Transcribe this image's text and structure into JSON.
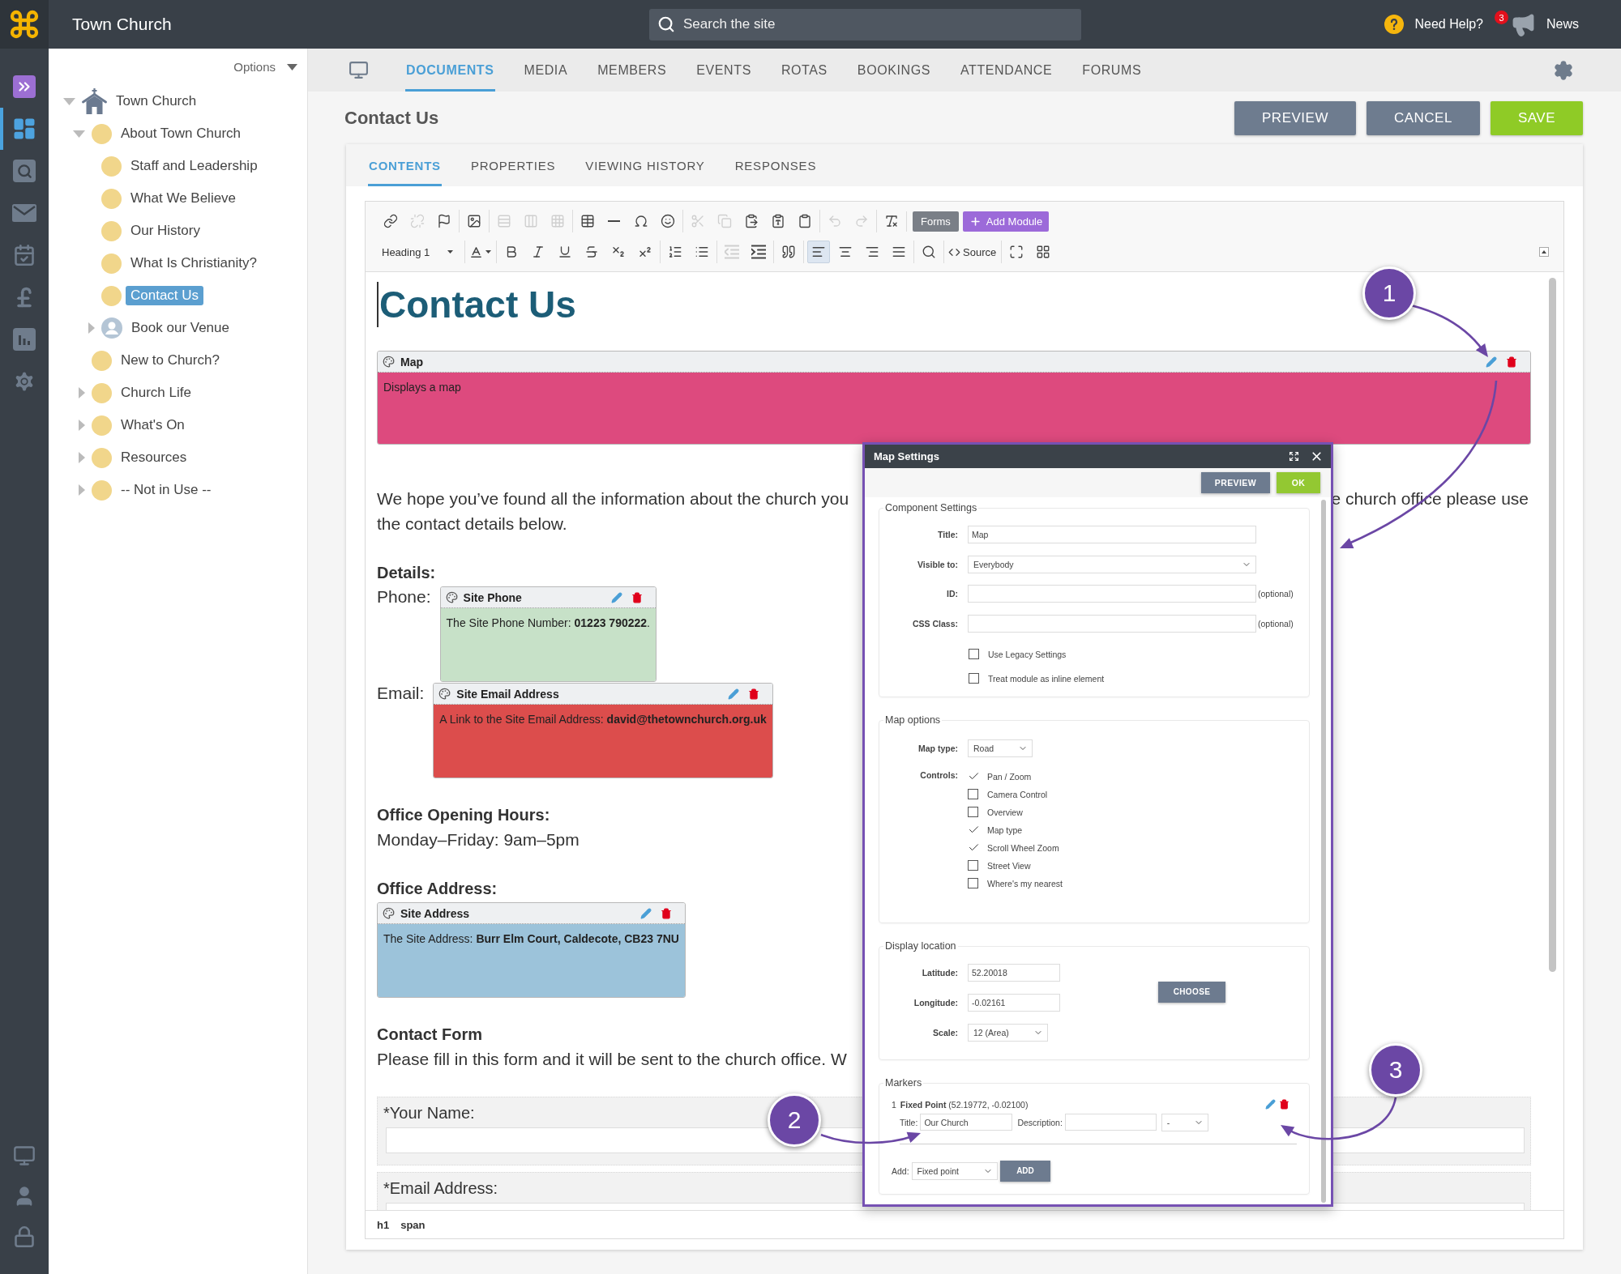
{
  "top_bar": {
    "brand": "Town Church",
    "search": {
      "placeholder": "Search the site"
    },
    "help": "Need Help?",
    "news_count": "3",
    "news": "News"
  },
  "rail": {
    "items": [
      {
        "kind": "expand",
        "selected": false
      },
      {
        "kind": "dashboard",
        "selected": true
      },
      {
        "kind": "search",
        "selected": false
      },
      {
        "kind": "mail",
        "selected": false
      },
      {
        "kind": "calendar",
        "selected": false
      },
      {
        "kind": "finance",
        "selected": false
      },
      {
        "kind": "reports",
        "selected": false
      },
      {
        "kind": "settings",
        "selected": false
      }
    ],
    "bottom_items": [
      {
        "kind": "display",
        "selected": false
      },
      {
        "kind": "account",
        "selected": false
      },
      {
        "kind": "lock",
        "selected": false
      }
    ]
  },
  "tree": {
    "options": "Options",
    "items": [
      {
        "label": "Town Church",
        "kind": "site",
        "expanded": true,
        "selected": false,
        "children": [
          {
            "label": "About Town Church",
            "kind": "page",
            "expanded": true,
            "selected": false,
            "children": [
              {
                "label": "Staff and Leadership",
                "kind": "page",
                "selected": false
              },
              {
                "label": "What We Believe",
                "kind": "page",
                "selected": false
              },
              {
                "label": "Our History",
                "kind": "page",
                "selected": false
              },
              {
                "label": "What Is Christianity?",
                "kind": "page",
                "selected": false
              },
              {
                "label": "Contact Us",
                "kind": "page",
                "selected": true
              },
              {
                "label": "Book our Venue",
                "kind": "user",
                "expanded": false,
                "selected": false
              }
            ]
          },
          {
            "label": "New to Church?",
            "kind": "page",
            "selected": false
          },
          {
            "label": "Church Life",
            "kind": "page",
            "expanded": false,
            "selected": false
          },
          {
            "label": "What's On",
            "kind": "page",
            "expanded": false,
            "selected": false
          },
          {
            "label": "Resources",
            "kind": "page",
            "expanded": false,
            "selected": false
          },
          {
            "label": "-- Not in Use --",
            "kind": "page",
            "expanded": false,
            "selected": false
          }
        ]
      }
    ]
  },
  "nav": {
    "tabs": [
      {
        "label": "DOCUMENTS",
        "selected": true
      },
      {
        "label": "MEDIA",
        "selected": false
      },
      {
        "label": "MEMBERS",
        "selected": false
      },
      {
        "label": "EVENTS",
        "selected": false
      },
      {
        "label": "ROTAS",
        "selected": false
      },
      {
        "label": "BOOKINGS",
        "selected": false
      },
      {
        "label": "ATTENDANCE",
        "selected": false
      },
      {
        "label": "FORUMS",
        "selected": false
      }
    ]
  },
  "page": {
    "title": "Contact Us",
    "buttons": [
      {
        "label": "PREVIEW",
        "kind": "secondary"
      },
      {
        "label": "CANCEL",
        "kind": "secondary"
      },
      {
        "label": "SAVE",
        "kind": "primary"
      }
    ]
  },
  "card_tabs": [
    {
      "label": "CONTENTS",
      "selected": true
    },
    {
      "label": "PROPERTIES",
      "selected": false
    },
    {
      "label": "VIEWING HISTORY",
      "selected": false
    },
    {
      "label": "RESPONSES",
      "selected": false
    }
  ],
  "editor": {
    "toolbar": [
      [
        [
          {
            "kind": "link",
            "disabled": false
          },
          {
            "kind": "unlink",
            "disabled": true
          },
          {
            "kind": "anchor",
            "disabled": false
          }
        ],
        [
          {
            "kind": "image",
            "disabled": false
          }
        ],
        [
          {
            "kind": "rows",
            "disabled": true
          },
          {
            "kind": "columns",
            "disabled": true
          },
          {
            "kind": "cells",
            "disabled": true
          }
        ],
        [
          {
            "kind": "table",
            "disabled": false
          },
          {
            "kind": "horizontal_line",
            "disabled": false
          },
          {
            "kind": "special_character",
            "disabled": false
          },
          {
            "kind": "emoji",
            "disabled": false
          }
        ],
        [
          {
            "kind": "cut",
            "disabled": true
          },
          {
            "kind": "copy",
            "disabled": true
          },
          {
            "kind": "paste",
            "disabled": false
          },
          {
            "kind": "paste_text",
            "disabled": false
          },
          {
            "kind": "paste_word",
            "disabled": false
          }
        ],
        [
          {
            "kind": "undo",
            "disabled": true
          },
          {
            "kind": "redo",
            "disabled": true
          }
        ],
        [
          {
            "kind": "remove_format",
            "disabled": false
          }
        ],
        [
          {
            "kind": "forms",
            "label": "Forms",
            "disabled": false
          },
          {
            "kind": "add_module",
            "label": "Add Module",
            "disabled": false
          }
        ]
      ],
      [
        [
          {
            "kind": "format",
            "label": "Heading 1",
            "disabled": false
          }
        ],
        [
          {
            "kind": "text_color",
            "disabled": false
          }
        ],
        [
          {
            "kind": "bold",
            "disabled": false
          },
          {
            "kind": "italic",
            "disabled": false
          },
          {
            "kind": "underline",
            "disabled": false
          },
          {
            "kind": "strikethrough",
            "disabled": false
          },
          {
            "kind": "subscript",
            "disabled": false
          },
          {
            "kind": "superscript",
            "disabled": false
          }
        ],
        [
          {
            "kind": "numbered_list",
            "disabled": false
          },
          {
            "kind": "bullet_list",
            "disabled": false
          }
        ],
        [
          {
            "kind": "outdent",
            "disabled": true
          },
          {
            "kind": "indent",
            "disabled": false
          }
        ],
        [
          {
            "kind": "blockquote",
            "disabled": false
          }
        ],
        [
          {
            "kind": "align_left",
            "disabled": false,
            "selected": true
          },
          {
            "kind": "align_center",
            "disabled": false,
            "selected": false
          },
          {
            "kind": "align_right",
            "disabled": false,
            "selected": false
          },
          {
            "kind": "align_justify",
            "disabled": false,
            "selected": false
          }
        ],
        [
          {
            "kind": "find",
            "disabled": false
          }
        ],
        [
          {
            "kind": "source",
            "label": "Source",
            "disabled": false
          }
        ],
        [
          {
            "kind": "maximize",
            "disabled": false
          },
          {
            "kind": "show_blocks",
            "disabled": false
          }
        ]
      ]
    ],
    "blocks": [
      {
        "kind": "title",
        "text": "Contact Us"
      },
      {
        "kind": "wide_module",
        "title": "Map",
        "body": "Displays a map",
        "color": "#dd4a7e"
      },
      {
        "kind": "covered_paragraph",
        "start": "We hope you’ve found all the information about the church you",
        "end": "e church office please use",
        "next_line": "the contact details below."
      },
      {
        "kind": "heading",
        "text": "Details:"
      },
      {
        "kind": "labelled_module",
        "label": "Phone:",
        "title": "Site Phone",
        "body": "The Site Phone Number: **01223 790222**.",
        "color": "#c7e1c8"
      },
      {
        "kind": "labelled_module",
        "label": "Email:",
        "title": "Site Email Address",
        "body": "A Link to the Site Email Address: **david@thetownchurch.org.uk**",
        "color": "#dc4d4c"
      },
      {
        "kind": "heading",
        "text": "Office Opening Hours:"
      },
      {
        "kind": "text",
        "text": "Monday–Friday: 9am–5pm"
      },
      {
        "kind": "heading",
        "text": "Office Address:"
      },
      {
        "kind": "module",
        "title": "Site Address",
        "body": "The Site Address: **Burr Elm Court, Caldecote, CB23 7NU**",
        "color": "#9cc3da"
      },
      {
        "kind": "heading",
        "text": "Contact Form"
      },
      {
        "kind": "text",
        "text": "Please fill in this form and it will be sent to the church office. W"
      },
      {
        "kind": "form_field",
        "label": "*Your Name:"
      },
      {
        "kind": "form_field",
        "label": "*Email Address:"
      }
    ],
    "status_path": [
      "h1",
      "span"
    ]
  },
  "dialog": {
    "title": "Map Settings",
    "buttons": [
      {
        "label": "PREVIEW",
        "kind": "secondary"
      },
      {
        "label": "OK",
        "kind": "primary"
      }
    ],
    "sections": [
      {
        "kind": "fields",
        "title": "Component Settings",
        "fields": [
          {
            "kind": "text",
            "label": "Title:",
            "value": "Map"
          },
          {
            "kind": "wide_select",
            "label": "Visible to:",
            "value": "Everybody"
          },
          {
            "kind": "text",
            "label": "ID:",
            "note": "(optional)"
          },
          {
            "kind": "text",
            "label": "CSS Class:",
            "note": "(optional)"
          }
        ],
        "checkboxes": [
          {
            "label": "Use Legacy Settings",
            "checked": false
          },
          {
            "label": "Treat module as inline element",
            "checked": false
          }
        ]
      },
      {
        "kind": "options",
        "title": "Map options",
        "map_type": {
          "label": "Map type:",
          "value": "Road"
        },
        "controls": {
          "label": "Controls:",
          "items": [
            {
              "label": "Pan / Zoom",
              "checked": true
            },
            {
              "label": "Camera Control",
              "checked": false
            },
            {
              "label": "Overview",
              "checked": false
            },
            {
              "label": "Map type",
              "checked": true
            },
            {
              "label": "Scroll Wheel Zoom",
              "checked": true
            },
            {
              "label": "Street View",
              "checked": false
            },
            {
              "label": "Where's my nearest",
              "checked": false
            }
          ]
        }
      },
      {
        "kind": "location",
        "title": "Display location",
        "fields": [
          {
            "kind": "short_text",
            "label": "Latitude:",
            "value": "52.20018"
          },
          {
            "kind": "short_text",
            "label": "Longitude:",
            "value": "-0.02161"
          },
          {
            "kind": "select",
            "label": "Scale:",
            "value": "12 (Area)"
          }
        ],
        "button": "CHOOSE"
      },
      {
        "kind": "markers",
        "title": "Markers",
        "markers": [
          {
            "number": "1",
            "summary": "**Fixed Point** (52.19772, -0.02100)",
            "title_label": "Title:",
            "title": "Our Church",
            "description_label": "Description:",
            "option": "-"
          }
        ],
        "add_label": "Add:",
        "add_value": "Fixed point",
        "add_button": "ADD"
      }
    ]
  },
  "annotations": [
    {
      "label": "1"
    },
    {
      "label": "2"
    },
    {
      "label": "3"
    }
  ]
}
